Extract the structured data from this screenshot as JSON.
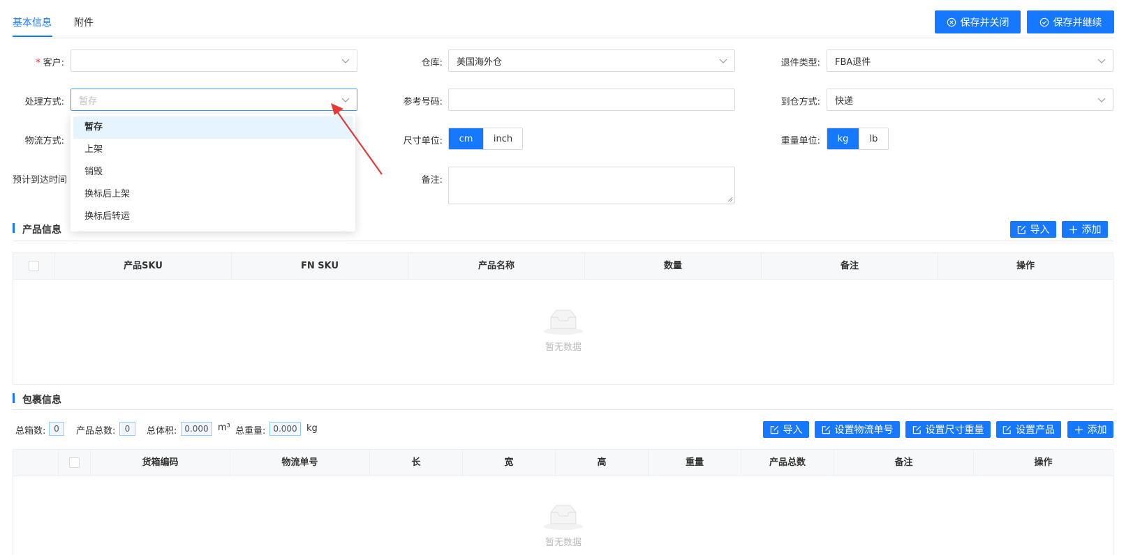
{
  "tabs": {
    "basic": "基本信息",
    "attachment": "附件"
  },
  "actions": {
    "save_close": "保存并关闭",
    "save_continue": "保存并继续"
  },
  "form": {
    "customer_label": "客户:",
    "customer_required": "*",
    "customer_value": "",
    "warehouse_label": "仓库:",
    "warehouse_value": "美国海外仓",
    "return_type_label": "退件类型:",
    "return_type_value": "FBA退件",
    "handling_label": "处理方式:",
    "handling_placeholder": "暂存",
    "reference_label": "参考号码:",
    "reference_value": "",
    "arrival_label": "到仓方式:",
    "arrival_value": "快递",
    "logistics_label": "物流方式:",
    "size_unit_label": "尺寸单位:",
    "size_units": [
      "cm",
      "inch"
    ],
    "size_unit_selected": "cm",
    "weight_unit_label": "重量单位:",
    "weight_units": [
      "kg",
      "lb"
    ],
    "weight_unit_selected": "kg",
    "eta_label": "预计到达时间",
    "remark_label": "备注:"
  },
  "dropdown": {
    "options": [
      "暂存",
      "上架",
      "销毁",
      "换标后上架",
      "换标后转运"
    ],
    "selected": "暂存"
  },
  "product": {
    "title": "产品信息",
    "import": "导入",
    "add": "添加",
    "columns": [
      "产品SKU",
      "FN SKU",
      "产品名称",
      "数量",
      "备注",
      "操作"
    ],
    "empty": "暂无数据"
  },
  "package": {
    "title": "包裹信息",
    "total_boxes_label": "总箱数:",
    "total_boxes": "0",
    "total_products_label": "产品总数:",
    "total_products": "0",
    "total_volume_label": "总体积:",
    "total_volume": "0.000",
    "volume_unit": "m³",
    "total_weight_label": "总重量:",
    "total_weight": "0.000",
    "weight_unit": "kg",
    "buttons": {
      "import": "导入",
      "set_tracking": "设置物流单号",
      "set_dimensions": "设置尺寸重量",
      "set_product": "设置产品",
      "add": "添加"
    },
    "columns": [
      "货箱编码",
      "物流单号",
      "长",
      "宽",
      "高",
      "重量",
      "产品总数",
      "备注",
      "操作"
    ],
    "empty": "暂无数据"
  },
  "colors": {
    "primary": "#1677ff",
    "required": "#f5222d",
    "arrow": "#e53935"
  }
}
